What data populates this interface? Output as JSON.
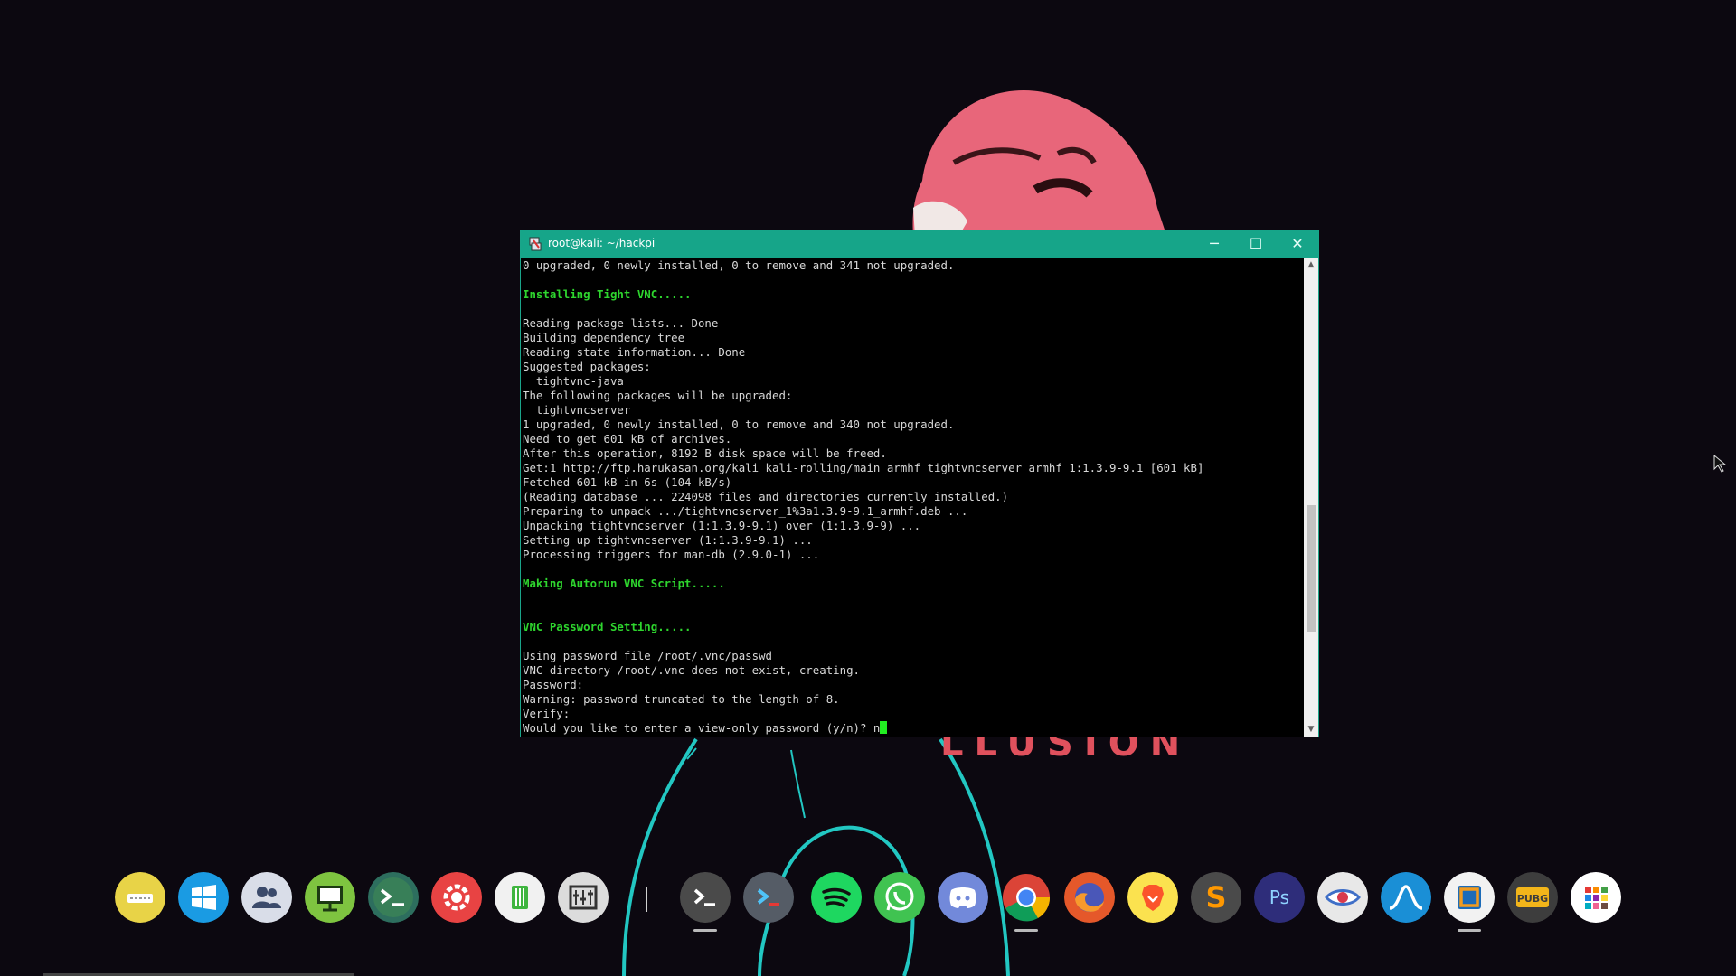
{
  "wallpaper": {
    "illusion_text": "LLUSION",
    "colors": {
      "background": "#0c0810",
      "mask": "#e8667a",
      "neon": "#22c7c2"
    }
  },
  "window": {
    "title": "root@kali: ~/hackpi",
    "titlebar_color": "#16a589",
    "controls": {
      "minimize": "─",
      "maximize": "☐",
      "close": "✕"
    }
  },
  "terminal": {
    "lines": [
      {
        "text": "0 upgraded, 0 newly installed, 0 to remove and 341 not upgraded.",
        "style": "normal"
      },
      {
        "text": "",
        "style": "normal"
      },
      {
        "text": "Installing Tight VNC.....",
        "style": "green"
      },
      {
        "text": "",
        "style": "normal"
      },
      {
        "text": "Reading package lists... Done",
        "style": "normal"
      },
      {
        "text": "Building dependency tree",
        "style": "normal"
      },
      {
        "text": "Reading state information... Done",
        "style": "normal"
      },
      {
        "text": "Suggested packages:",
        "style": "normal"
      },
      {
        "text": "  tightvnc-java",
        "style": "normal"
      },
      {
        "text": "The following packages will be upgraded:",
        "style": "normal"
      },
      {
        "text": "  tightvncserver",
        "style": "normal"
      },
      {
        "text": "1 upgraded, 0 newly installed, 0 to remove and 340 not upgraded.",
        "style": "normal"
      },
      {
        "text": "Need to get 601 kB of archives.",
        "style": "normal"
      },
      {
        "text": "After this operation, 8192 B disk space will be freed.",
        "style": "normal"
      },
      {
        "text": "Get:1 http://ftp.harukasan.org/kali kali-rolling/main armhf tightvncserver armhf 1:1.3.9-9.1 [601 kB]",
        "style": "normal"
      },
      {
        "text": "Fetched 601 kB in 6s (104 kB/s)",
        "style": "normal"
      },
      {
        "text": "(Reading database ... 224098 files and directories currently installed.)",
        "style": "normal"
      },
      {
        "text": "Preparing to unpack .../tightvncserver_1%3a1.3.9-9.1_armhf.deb ...",
        "style": "normal"
      },
      {
        "text": "Unpacking tightvncserver (1:1.3.9-9.1) over (1:1.3.9-9) ...",
        "style": "normal"
      },
      {
        "text": "Setting up tightvncserver (1:1.3.9-9.1) ...",
        "style": "normal"
      },
      {
        "text": "Processing triggers for man-db (2.9.0-1) ...",
        "style": "normal"
      },
      {
        "text": "",
        "style": "normal"
      },
      {
        "text": "Making Autorun VNC Script.....",
        "style": "green"
      },
      {
        "text": "",
        "style": "normal"
      },
      {
        "text": "",
        "style": "normal"
      },
      {
        "text": "VNC Password Setting.....",
        "style": "green"
      },
      {
        "text": "",
        "style": "normal"
      },
      {
        "text": "Using password file /root/.vnc/passwd",
        "style": "normal"
      },
      {
        "text": "VNC directory /root/.vnc does not exist, creating.",
        "style": "normal"
      },
      {
        "text": "Password:",
        "style": "normal"
      },
      {
        "text": "Warning: password truncated to the length of 8.",
        "style": "normal"
      },
      {
        "text": "Verify:",
        "style": "normal"
      }
    ],
    "prompt_line": "Would you like to enter a view-only password (y/n)? n",
    "scroll_position_fraction": 0.72
  },
  "dock": {
    "items": [
      {
        "name": "keyboard-icon",
        "color": "#e8d347",
        "running": false
      },
      {
        "name": "windows-icon",
        "color": "#1a9be3",
        "running": false
      },
      {
        "name": "users-icon",
        "color": "#d9dde8",
        "running": false
      },
      {
        "name": "remote-desktop-icon",
        "color": "#7ec440",
        "running": false
      },
      {
        "name": "terminal-globe-icon",
        "color": "#2d6e5e",
        "running": false
      },
      {
        "name": "settings-icon",
        "color": "#e84343",
        "running": false
      },
      {
        "name": "file-manager-icon",
        "color": "#f1f1f1",
        "running": false
      },
      {
        "name": "mixer-icon",
        "color": "#dcdcdc",
        "running": false
      },
      {
        "name": "terminal-icon",
        "color": "#4a4a4a",
        "running": true
      },
      {
        "name": "powershell-icon",
        "color": "#555c66",
        "running": false
      },
      {
        "name": "spotify-icon",
        "color": "#1ed760",
        "running": false
      },
      {
        "name": "whatsapp-icon",
        "color": "#40c351",
        "running": false
      },
      {
        "name": "discord-icon",
        "color": "#7289da",
        "running": false
      },
      {
        "name": "chrome-icon",
        "color": "#ffffff",
        "running": true
      },
      {
        "name": "firefox-icon",
        "color": "#e5582a",
        "running": false
      },
      {
        "name": "brave-icon",
        "color": "#fbe24f",
        "running": false
      },
      {
        "name": "sublime-icon",
        "color": "#4a4a4a",
        "running": false
      },
      {
        "name": "photoshop-icon",
        "color": "#2e2d7a",
        "running": false
      },
      {
        "name": "eye-icon",
        "color": "#e8e8e8",
        "running": false
      },
      {
        "name": "wireshark-icon",
        "color": "#1a8fd6",
        "running": false
      },
      {
        "name": "virtualbox-icon",
        "color": "#f2f2f2",
        "running": true
      },
      {
        "name": "pubg-icon",
        "color": "#3d3d3d",
        "running": false
      },
      {
        "name": "app-grid-icon",
        "color": "#ffffff",
        "running": false
      }
    ],
    "icon_labels": {
      "photoshop": "Ps",
      "sublime": "S",
      "pubg": "PUBG"
    }
  }
}
